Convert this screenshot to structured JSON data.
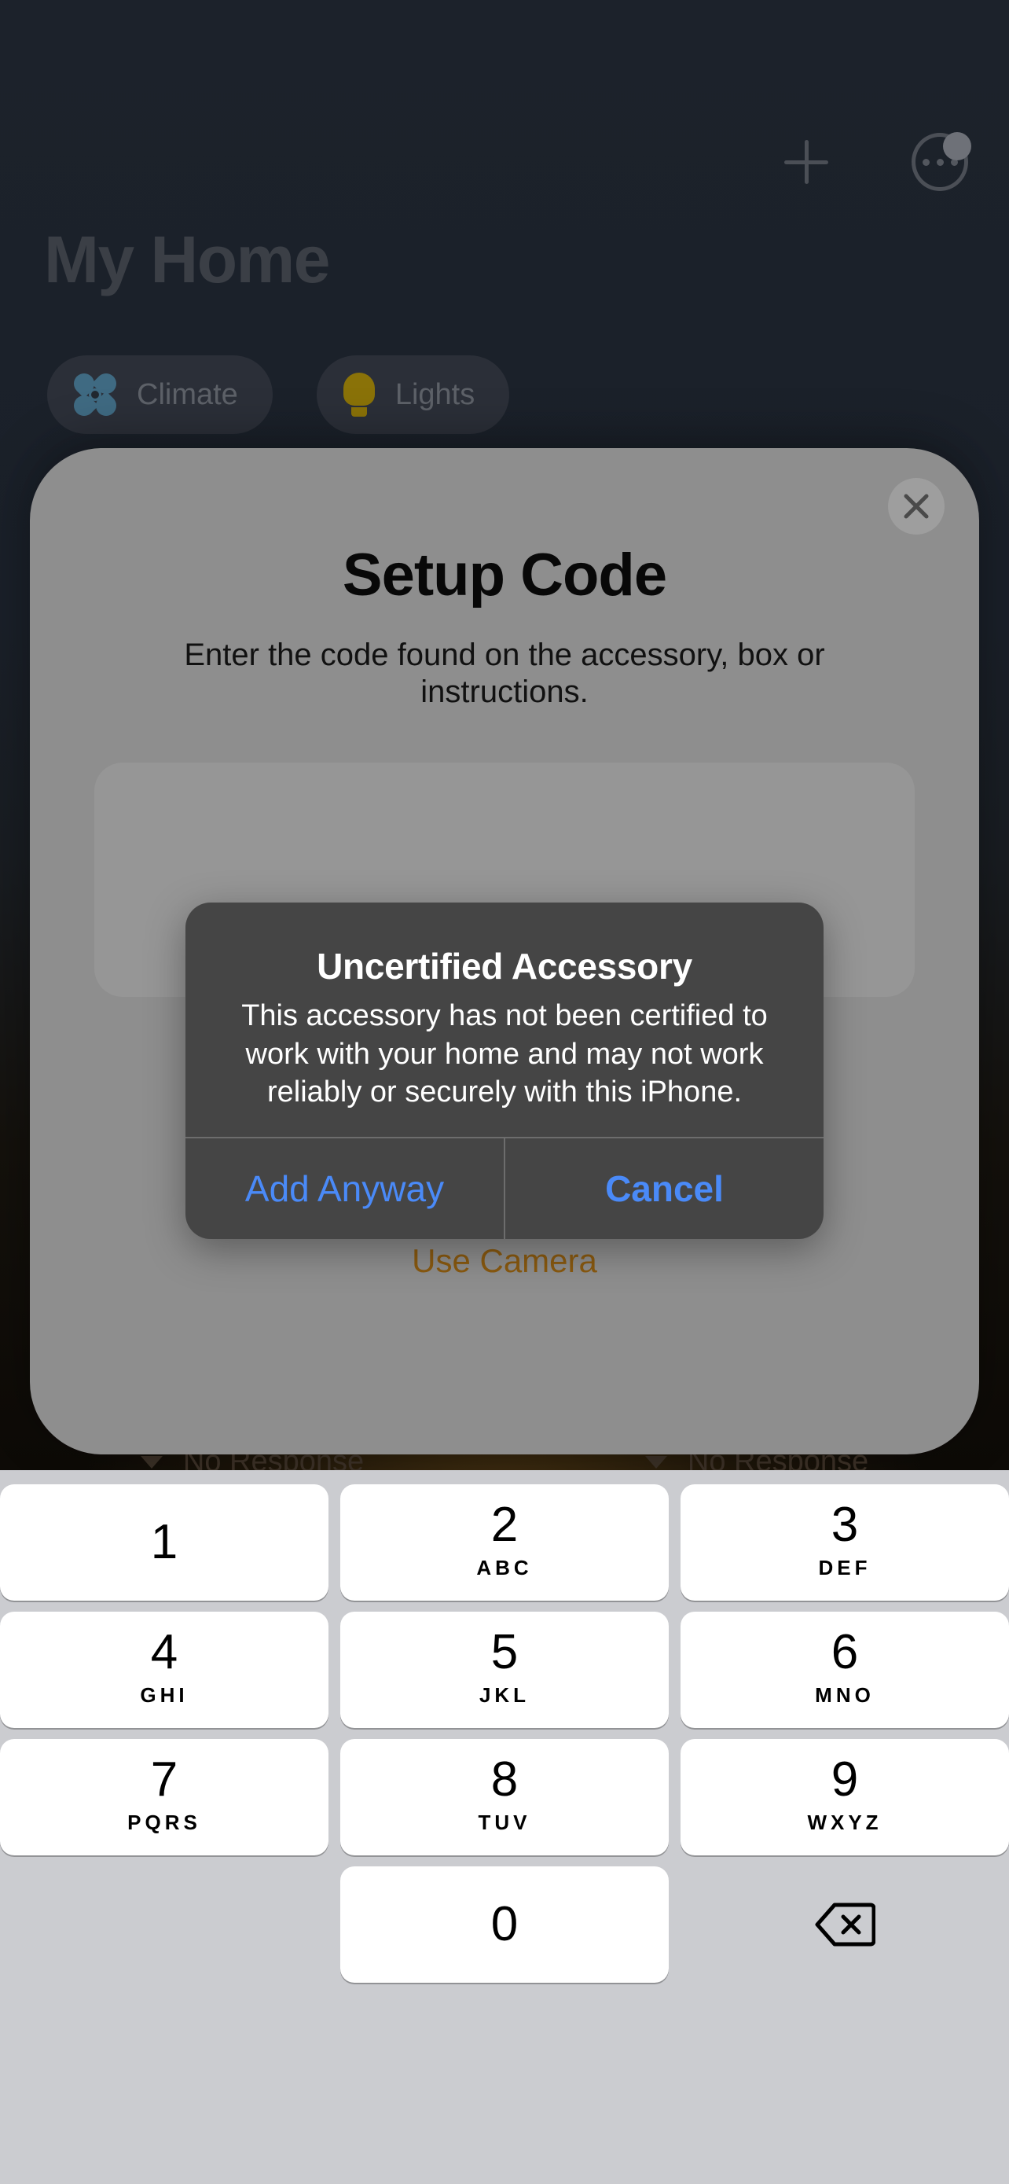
{
  "home": {
    "title": "My Home",
    "add_icon": "plus-icon",
    "more_icon": "ellipsis-circle-icon",
    "categories": [
      {
        "label": "Climate",
        "icon": "fan-icon"
      },
      {
        "label": "Lights",
        "icon": "lightbulb-icon"
      }
    ],
    "status_tiles": [
      {
        "status": "No Response"
      },
      {
        "status": "No Response"
      }
    ]
  },
  "sheet": {
    "title": "Setup Code",
    "subtitle": "Enter the code found on the accessory, box or instructions.",
    "close_icon": "close-icon",
    "code_value": "",
    "use_camera_label": "Use Camera",
    "use_camera_color": "#8a5a10"
  },
  "alert": {
    "title": "Uncertified Accessory",
    "message": "This accessory has not been certified to work with your home and may not work reliably or securely with this iPhone.",
    "buttons": [
      {
        "label": "Add Anyway",
        "emphasis": "normal"
      },
      {
        "label": "Cancel",
        "emphasis": "bold"
      }
    ],
    "tint_color": "#4a8af8"
  },
  "keypad": {
    "rows": [
      [
        {
          "num": "1",
          "sub": ""
        },
        {
          "num": "2",
          "sub": "ABC"
        },
        {
          "num": "3",
          "sub": "DEF"
        }
      ],
      [
        {
          "num": "4",
          "sub": "GHI"
        },
        {
          "num": "5",
          "sub": "JKL"
        },
        {
          "num": "6",
          "sub": "MNO"
        }
      ],
      [
        {
          "num": "7",
          "sub": "PQRS"
        },
        {
          "num": "8",
          "sub": "TUV"
        },
        {
          "num": "9",
          "sub": "WXYZ"
        }
      ]
    ],
    "zero": {
      "num": "0",
      "sub": ""
    },
    "delete_icon": "backspace-icon"
  }
}
